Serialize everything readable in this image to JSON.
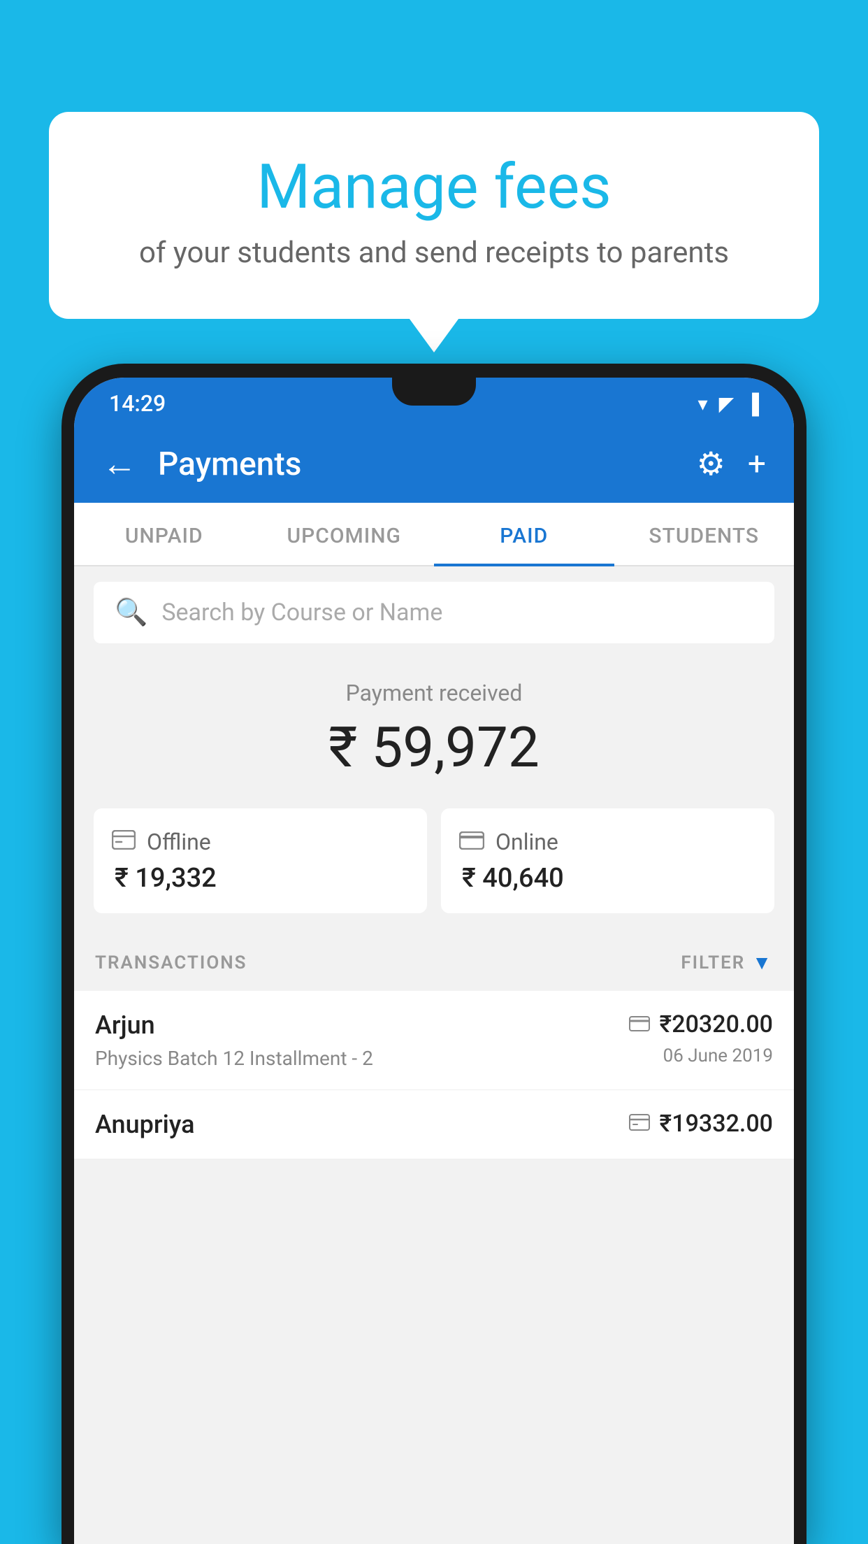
{
  "background_color": "#1ab8e8",
  "bubble": {
    "title": "Manage fees",
    "subtitle": "of your students and send receipts to parents"
  },
  "status_bar": {
    "time": "14:29",
    "wifi_icon": "▲",
    "signal_icon": "▲",
    "battery_icon": "▌"
  },
  "app_bar": {
    "title": "Payments",
    "back_label": "←",
    "settings_label": "⚙",
    "add_label": "+"
  },
  "tabs": [
    {
      "label": "UNPAID",
      "active": false
    },
    {
      "label": "UPCOMING",
      "active": false
    },
    {
      "label": "PAID",
      "active": true
    },
    {
      "label": "STUDENTS",
      "active": false
    }
  ],
  "search": {
    "placeholder": "Search by Course or Name"
  },
  "payment_summary": {
    "label": "Payment received",
    "amount": "₹ 59,972",
    "offline": {
      "icon": "💳",
      "type": "Offline",
      "amount": "₹ 19,332"
    },
    "online": {
      "icon": "💳",
      "type": "Online",
      "amount": "₹ 40,640"
    }
  },
  "transactions": {
    "label": "TRANSACTIONS",
    "filter_label": "FILTER",
    "items": [
      {
        "name": "Arjun",
        "description": "Physics Batch 12 Installment - 2",
        "amount": "₹20320.00",
        "date": "06 June 2019",
        "payment_type": "online"
      },
      {
        "name": "Anupriya",
        "description": "",
        "amount": "₹19332.00",
        "date": "",
        "payment_type": "offline"
      }
    ]
  }
}
